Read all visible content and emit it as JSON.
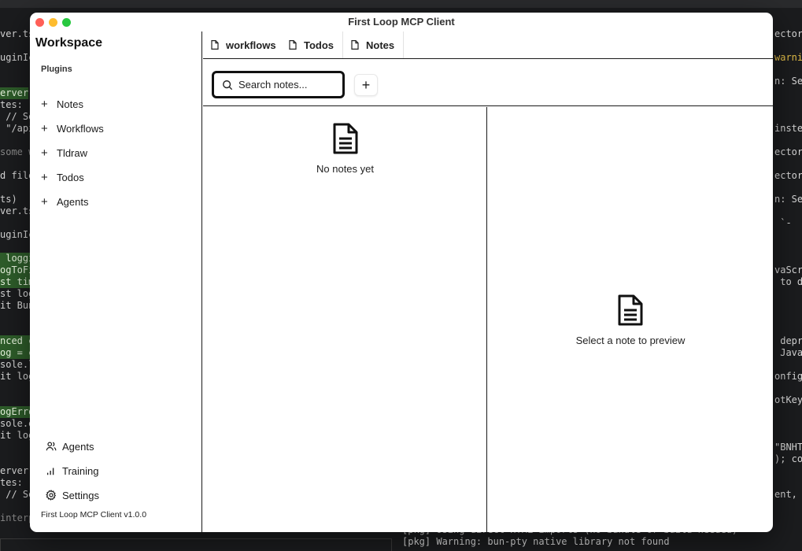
{
  "window": {
    "title": "First Loop MCP Client"
  },
  "sidebar": {
    "workspace_title": "Workspace",
    "plugins_heading": "Plugins",
    "plugins": [
      {
        "label": "Notes",
        "icon": "plus-icon"
      },
      {
        "label": "Workflows",
        "icon": "plus-icon"
      },
      {
        "label": "Tldraw",
        "icon": "plus-icon"
      },
      {
        "label": "Todos",
        "icon": "plus-icon"
      },
      {
        "label": "Agents",
        "icon": "plus-icon"
      }
    ],
    "bottom_nav": [
      {
        "label": "Agents",
        "icon": "users-icon"
      },
      {
        "label": "Training",
        "icon": "bar-chart-icon"
      },
      {
        "label": "Settings",
        "icon": "gear-icon"
      }
    ],
    "version": "First Loop MCP Client v1.0.0"
  },
  "tabs": [
    {
      "label": "workflows",
      "icon": "file-icon"
    },
    {
      "label": "Todos",
      "icon": "file-icon"
    },
    {
      "label": "Notes",
      "icon": "file-icon",
      "active": true
    }
  ],
  "notes": {
    "search_placeholder": "Search notes...",
    "search_value": "",
    "add_label": "+",
    "empty_list": "No notes yet",
    "empty_preview": "Select a note to preview"
  },
  "terminal": {
    "left_fragments": [
      "ver.ts",
      "uginIc",
      "erver",
      "tes: -",
      " // Se",
      " \"/api",
      "some w",
      "d file",
      "ts)",
      "ver.ts",
      "uginIc",
      " loggi",
      "ogToFi",
      "st tim",
      "st log",
      "it Bun",
      "nced c",
      "og = c",
      "sole.l",
      "it log",
      "ogErro",
      "sole.e",
      "it log",
      "erver",
      "tes: -",
      " // Se",
      "interp"
    ],
    "right_fragments": [
      "ector",
      "warni",
      "n: Sel",
      "inste",
      "ector(",
      "ector",
      "n: Sel",
      " `-",
      "vaScri",
      " to d",
      " depre",
      " JavaS",
      "onfig)",
      "otKeyI",
      "\"BNHT",
      "); con",
      "ent, u"
    ],
    "bottom_lines": [
      "[pkg] Using direct HTML imports (no bundle or build needed)",
      "[pkg] Warning: bun-pty native library not found"
    ]
  },
  "colors": {
    "accent_green": "#2e5d2a",
    "window_bg": "#ffffff",
    "border": "#1a1a1a"
  }
}
